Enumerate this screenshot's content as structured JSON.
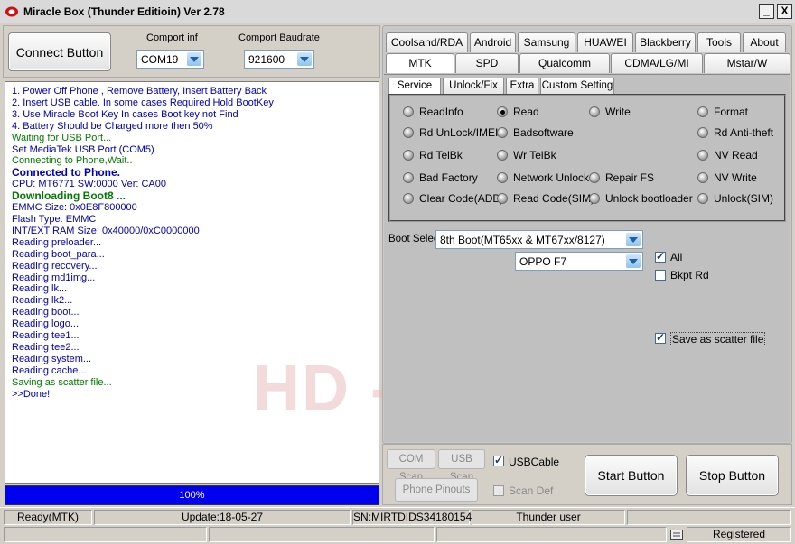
{
  "window": {
    "title": "Miracle Box (Thunder Editioin) Ver 2.78",
    "minimize": "_",
    "close": "X"
  },
  "connect": {
    "button_label": "Connect Button",
    "comport_label": "Comport inf",
    "comport_value": "COM19",
    "baud_label": "Comport Baudrate",
    "baud_value": "921600"
  },
  "log": [
    {
      "text": "1. Power Off Phone , Remove Battery, Insert Battery Back",
      "style": "blue"
    },
    {
      "text": "2. Insert USB cable. In some cases Required Hold BootKey",
      "style": "blue"
    },
    {
      "text": "3. Use Miracle Boot Key In cases Boot key not Find",
      "style": "blue"
    },
    {
      "text": "4. Battery Should be Charged more then 50%",
      "style": "blue"
    },
    {
      "text": "Waiting for USB Port...",
      "style": "green"
    },
    {
      "text": "Set MediaTek USB Port (COM5)",
      "style": "blue"
    },
    {
      "text": "Connecting to Phone,Wait..",
      "style": "green"
    },
    {
      "text": " Connected to Phone.",
      "style": "blue-bold"
    },
    {
      "text": "CPU: MT6771 SW:0000 Ver: CA00",
      "style": "blue"
    },
    {
      "text": " Downloading Boot8 ...",
      "style": "green-bold"
    },
    {
      "text": "EMMC Size: 0x0E8F800000",
      "style": "blue"
    },
    {
      "text": "Flash Type: EMMC",
      "style": "blue"
    },
    {
      "text": "INT/EXT RAM  Size: 0x40000/0xC0000000",
      "style": "blue"
    },
    {
      "text": "Reading preloader...",
      "style": "blue"
    },
    {
      "text": "Reading boot_para...",
      "style": "blue"
    },
    {
      "text": "Reading recovery...",
      "style": "blue"
    },
    {
      "text": "Reading md1img...",
      "style": "blue"
    },
    {
      "text": "Reading lk...",
      "style": "blue"
    },
    {
      "text": "Reading lk2...",
      "style": "blue"
    },
    {
      "text": "Reading boot...",
      "style": "blue"
    },
    {
      "text": "Reading logo...",
      "style": "blue"
    },
    {
      "text": "Reading tee1...",
      "style": "blue"
    },
    {
      "text": "Reading tee2...",
      "style": "blue"
    },
    {
      "text": "Reading system...",
      "style": "blue"
    },
    {
      "text": "Reading cache...",
      "style": "blue"
    },
    {
      "text": "Saving as scatter file...",
      "style": "green"
    },
    {
      "text": ">>Done!",
      "style": "blue"
    }
  ],
  "watermark": "HD - SMART",
  "progress": {
    "value": 100,
    "label": "100%"
  },
  "tabs_row1": [
    "Coolsand/RDA",
    "Android",
    "Samsung",
    "HUAWEI",
    "Blackberry",
    "Tools",
    "About"
  ],
  "tabs_row2": [
    "MTK",
    "SPD",
    "Qualcomm",
    "CDMA/LG/MI",
    "Mstar/W"
  ],
  "active_tab": "MTK",
  "subtabs": [
    "Service",
    "Unlock/Fix",
    "Extra",
    "Custom Setting"
  ],
  "active_subtab": "Service",
  "options": [
    {
      "label": "ReadInfo",
      "selected": false
    },
    {
      "label": "Read",
      "selected": true
    },
    {
      "label": "Write",
      "selected": false
    },
    {
      "label": "Format",
      "selected": false
    },
    {
      "label": "Rd UnLock/IMEI",
      "selected": false
    },
    {
      "label": "Badsoftware",
      "selected": false
    },
    {
      "label": "Rd Anti-theft",
      "selected": false
    },
    {
      "label": "Rd TelBk",
      "selected": false
    },
    {
      "label": "Wr TelBk",
      "selected": false
    },
    {
      "label": "NV Read",
      "selected": false
    },
    {
      "label": "Bad Factory",
      "selected": false
    },
    {
      "label": "Network Unlock",
      "selected": false
    },
    {
      "label": "Repair FS",
      "selected": false
    },
    {
      "label": "NV Write",
      "selected": false
    },
    {
      "label": "Clear Code(ADB)",
      "selected": false
    },
    {
      "label": "Read Code(SIM)",
      "selected": false
    },
    {
      "label": "Unlock bootloader",
      "selected": false
    },
    {
      "label": "Unlock(SIM)",
      "selected": false
    }
  ],
  "boot": {
    "label": "Boot Selec",
    "value": "8th Boot(MT65xx & MT67xx/8127)",
    "model": "OPPO F7"
  },
  "checks": {
    "all": {
      "label": "All",
      "checked": true
    },
    "bkpt": {
      "label": "Bkpt Rd",
      "checked": false
    },
    "scatter": {
      "label": "Save as scatter file",
      "checked": true
    }
  },
  "bottom": {
    "com_scan": "COM Scan",
    "usb_scan": "USB Scan",
    "usbcable": "USBCable",
    "phone_pinouts": "Phone Pinouts",
    "scan_def": "Scan Def",
    "start": "Start Button",
    "stop": "Stop Button"
  },
  "status": {
    "mode": "Ready(MTK)",
    "update": "Update:18-05-27",
    "sn": "SN:MIRTDIDS34180154",
    "user": "Thunder user",
    "registered": "Registered"
  }
}
